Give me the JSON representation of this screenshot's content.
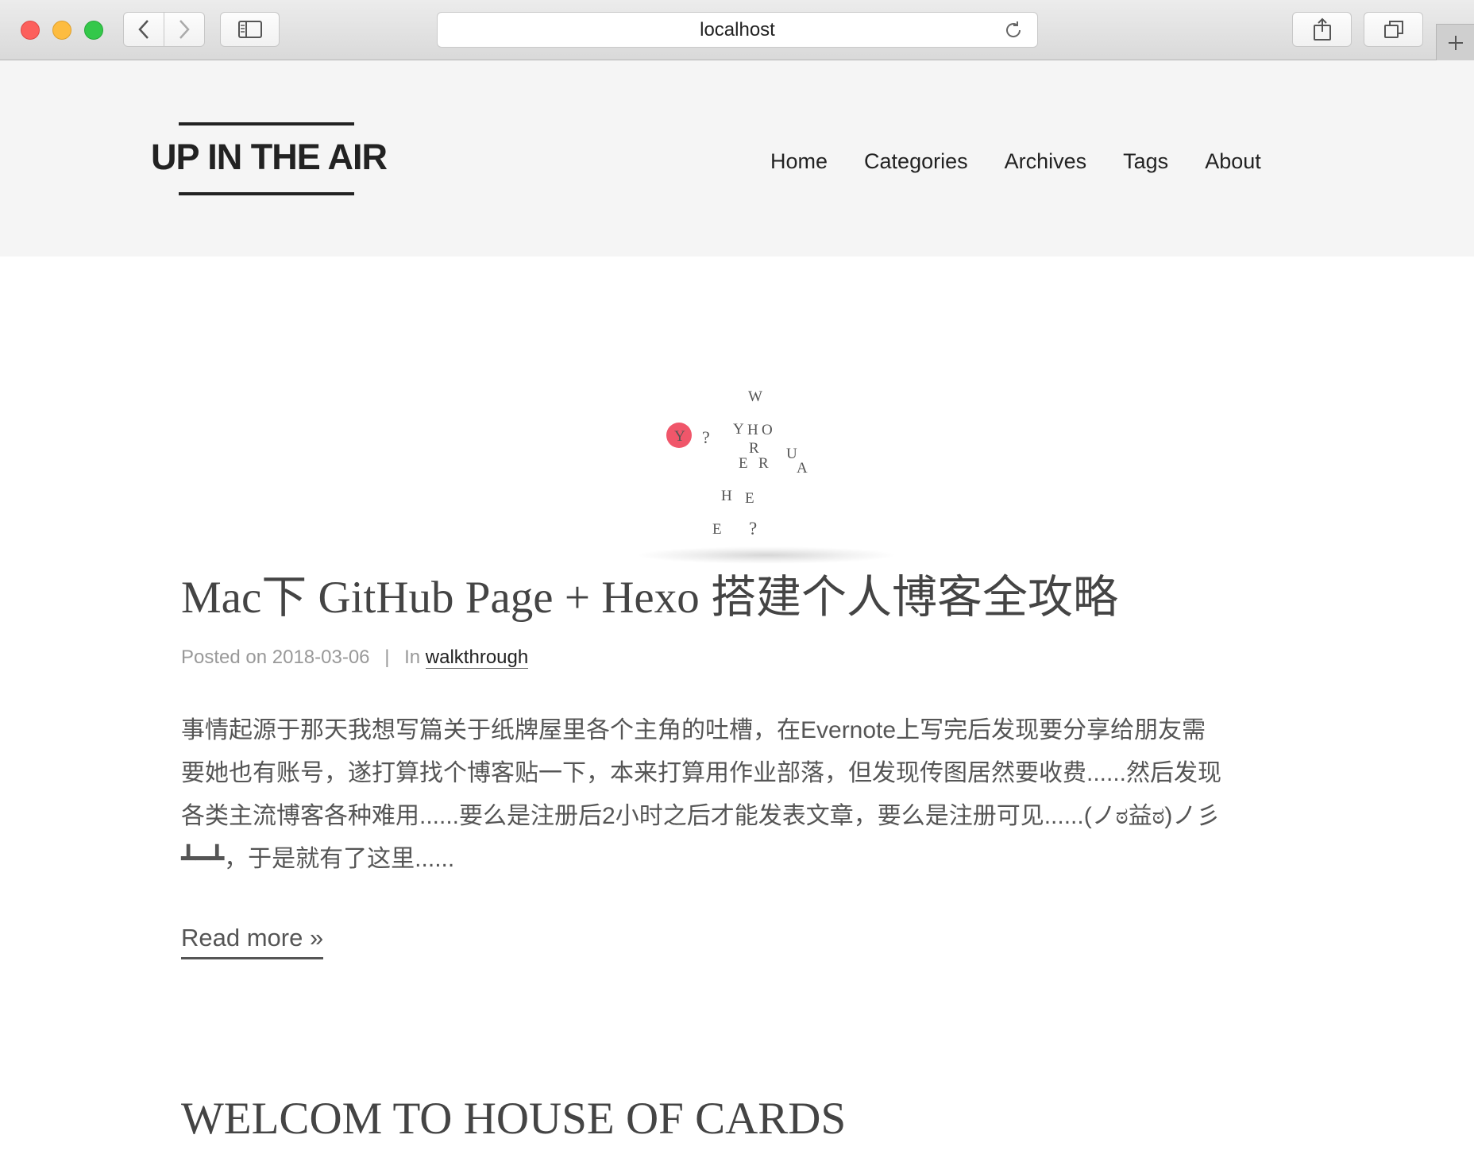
{
  "browser": {
    "url": "localhost",
    "icons": {
      "back": "chevron-left-icon",
      "forward": "chevron-right-icon",
      "sidebar": "sidebar-icon",
      "reload": "reload-icon",
      "share": "share-icon",
      "tabs": "tabs-overview-icon",
      "new_tab": "plus-icon"
    }
  },
  "site": {
    "title": "UP IN THE AIR",
    "nav": [
      "Home",
      "Categories",
      "Archives",
      "Tags",
      "About"
    ]
  },
  "animation": {
    "letters": [
      "W",
      "Y",
      "?",
      "Y",
      "H",
      "O",
      "R",
      "U",
      "E",
      "R",
      "A",
      "H",
      "E",
      "E",
      "?"
    ],
    "accent_color": "#f0566a"
  },
  "posts": [
    {
      "title": "Mac下 GitHub Page + Hexo 搭建个人博客全攻略",
      "posted_label": "Posted on",
      "date": "2018-03-06",
      "separator": "|",
      "in_label": "In",
      "category": "walkthrough",
      "excerpt_lines": [
        "事情起源于那天我想写篇关于纸牌屋里各个主角的吐槽，在Evernote上写完后发现要分享给朋友需",
        "要她也有账号，遂打算找个博客贴一下，本来打算用作业部落，但发现传图居然要收费......然后发现",
        "各类主流博客各种难用......要么是注册后2小时之后才能发表文章，要么是注册可见......(ノಠ益ಠ)ノ彡",
        "┻━┻，于是就有了这里......"
      ],
      "read_more": "Read more »"
    },
    {
      "title": "WELCOM TO HOUSE OF CARDS"
    }
  ]
}
